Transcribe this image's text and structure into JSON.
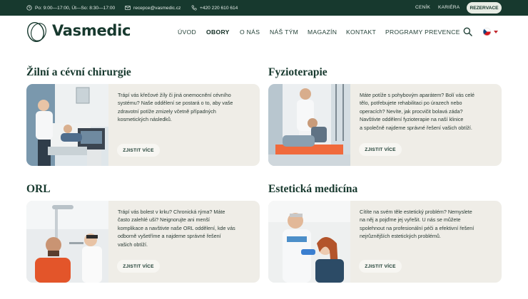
{
  "topbar": {
    "hours": "Po: 9:00—17:00, Út—So: 8:30—17:00",
    "email": "recepce@vasmedic.cz",
    "phone": "+420 220 610 614",
    "pricing": "CENÍK",
    "career": "KARIÉRA",
    "reserve": "REZERVACE"
  },
  "brand": {
    "name": "Vasmedic"
  },
  "nav": {
    "items": [
      "ÚVOD",
      "OBORY",
      "O NÁS",
      "NÁŠ TÝM",
      "MAGAZÍN",
      "KONTAKT",
      "PROGRAMY PREVENCE"
    ],
    "active": "OBORY"
  },
  "sections": [
    {
      "title": "Žilní a cévní chirurgie",
      "lines": [
        "Trápí vás křečové žíly či jiná onemocnění cévního",
        "systému? Naše oddělení se postará o to, aby vaše",
        "zdravotní potíže zmizely včetně případných",
        "kosmetických následků."
      ],
      "button": "ZJISTIT VÍCE"
    },
    {
      "title": "Fyzioterapie",
      "lines": [
        "Máte potíže s pohybovým aparátem? Bolí vás celé",
        "tělo, potřebujete rehabilitaci po úrazech nebo",
        "operacích? Nevíte, jak procvičit bolavá záda?",
        "Navštivte oddělení fyzioterapie na naší klinice",
        "a společně najdeme správné řešení vašich obtíží."
      ],
      "button": "ZJISTIT VÍCE"
    },
    {
      "title": "ORL",
      "lines": [
        "Trápí vás bolest v krku? Chronická rýma? Máte",
        "často zalehlé uši? Neignorujte ani menší",
        "komplikace a navštivte naše ORL oddělení, kde vás",
        "odborně vyšetříme a najdeme správné řešení",
        "vašich obtíží."
      ],
      "button": "ZJISTIT VÍCE"
    },
    {
      "title": "Estetická medicína",
      "lines": [
        "Cítíte na svém těle estetický problém? Nemyslete",
        "na něj a pojďme jej vyřešit. U nás se můžete",
        "spolehnout na profesionální péči a efektivní řešení",
        "nejrůznějších estetických problémů."
      ],
      "button": "ZJISTIT VÍCE"
    }
  ],
  "colors": {
    "topbar": "#17392e",
    "card": "#efede7",
    "accent": "#17392e",
    "reserve_bg": "#e7ece4"
  },
  "icons": [
    "clock-icon",
    "mail-icon",
    "phone-icon",
    "search-icon",
    "czech-flag-icon",
    "chevron-down-icon"
  ]
}
